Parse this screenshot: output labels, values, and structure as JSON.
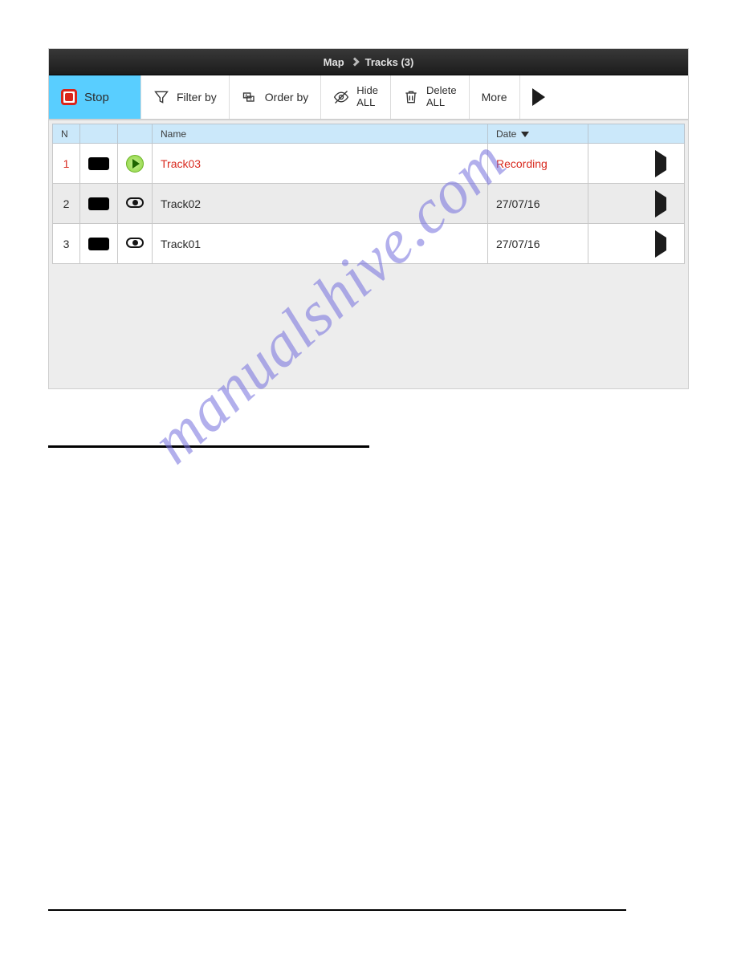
{
  "breadcrumb": {
    "map": "Map",
    "tracks": "Tracks (3)"
  },
  "toolbar": {
    "stop": "Stop",
    "filter": "Filter by",
    "order": "Order by",
    "hide_l1": "Hide",
    "hide_l2": "ALL",
    "delete_l1": "Delete",
    "delete_l2": "ALL",
    "more": "More"
  },
  "columns": {
    "n": "N",
    "name": "Name",
    "date": "Date"
  },
  "rows": [
    {
      "n": "1",
      "name": "Track03",
      "date": "Recording"
    },
    {
      "n": "2",
      "name": "Track02",
      "date": "27/07/16"
    },
    {
      "n": "3",
      "name": "Track01",
      "date": "27/07/16"
    }
  ],
  "watermark": "manualshive.com"
}
